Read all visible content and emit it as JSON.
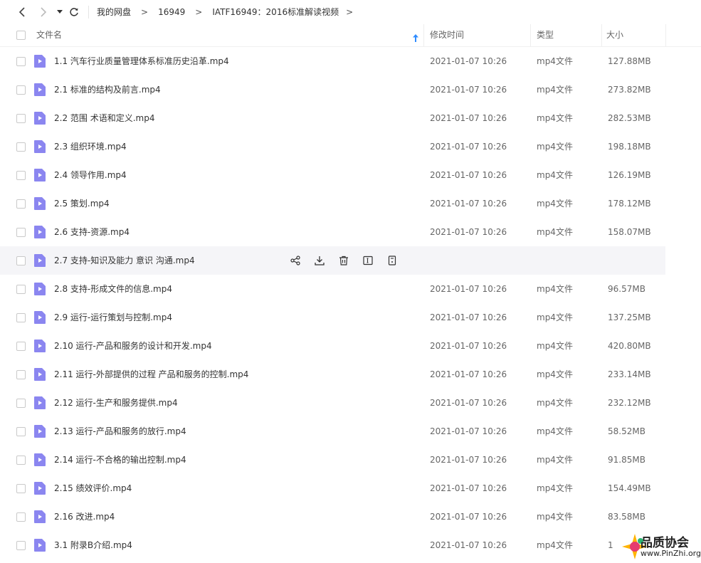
{
  "breadcrumb": {
    "items": [
      "我的网盘",
      "16949",
      "IATF16949：2016标准解读视频"
    ],
    "separator": ">"
  },
  "columns": {
    "name": "文件名",
    "modified": "修改时间",
    "type": "类型",
    "size": "大小"
  },
  "files": [
    {
      "name": "1.1 汽车行业质量管理体系标准历史沿革.mp4",
      "date": "2021-01-07 10:26",
      "type": "mp4文件",
      "size": "127.88MB"
    },
    {
      "name": "2.1 标准的结构及前言.mp4",
      "date": "2021-01-07 10:26",
      "type": "mp4文件",
      "size": "273.82MB"
    },
    {
      "name": "2.2 范围 术语和定义.mp4",
      "date": "2021-01-07 10:26",
      "type": "mp4文件",
      "size": "282.53MB"
    },
    {
      "name": "2.3 组织环境.mp4",
      "date": "2021-01-07 10:26",
      "type": "mp4文件",
      "size": "198.18MB"
    },
    {
      "name": "2.4 领导作用.mp4",
      "date": "2021-01-07 10:26",
      "type": "mp4文件",
      "size": "126.19MB"
    },
    {
      "name": "2.5 策划.mp4",
      "date": "2021-01-07 10:26",
      "type": "mp4文件",
      "size": "178.12MB"
    },
    {
      "name": "2.6 支持-资源.mp4",
      "date": "2021-01-07 10:26",
      "type": "mp4文件",
      "size": "158.07MB"
    },
    {
      "name": "2.7 支持-知识及能力 意识 沟通.mp4",
      "date": "",
      "type": "",
      "size": ""
    },
    {
      "name": "2.8 支持-形成文件的信息.mp4",
      "date": "2021-01-07 10:26",
      "type": "mp4文件",
      "size": "96.57MB"
    },
    {
      "name": "2.9 运行-运行策划与控制.mp4",
      "date": "2021-01-07 10:26",
      "type": "mp4文件",
      "size": "137.25MB"
    },
    {
      "name": "2.10 运行-产品和服务的设计和开发.mp4",
      "date": "2021-01-07 10:26",
      "type": "mp4文件",
      "size": "420.80MB"
    },
    {
      "name": "2.11 运行-外部提供的过程 产品和服务的控制.mp4",
      "date": "2021-01-07 10:26",
      "type": "mp4文件",
      "size": "233.14MB"
    },
    {
      "name": "2.12 运行-生产和服务提供.mp4",
      "date": "2021-01-07 10:26",
      "type": "mp4文件",
      "size": "232.12MB"
    },
    {
      "name": "2.13 运行-产品和服务的放行.mp4",
      "date": "2021-01-07 10:26",
      "type": "mp4文件",
      "size": "58.52MB"
    },
    {
      "name": "2.14 运行-不合格的输出控制.mp4",
      "date": "2021-01-07 10:26",
      "type": "mp4文件",
      "size": "91.85MB"
    },
    {
      "name": "2.15 绩效评价.mp4",
      "date": "2021-01-07 10:26",
      "type": "mp4文件",
      "size": "154.49MB"
    },
    {
      "name": "2.16 改进.mp4",
      "date": "2021-01-07 10:26",
      "type": "mp4文件",
      "size": "83.58MB"
    },
    {
      "name": "3.1 附录B介绍.mp4",
      "date": "2021-01-07 10:26",
      "type": "mp4文件",
      "size": "1"
    }
  ],
  "hover_actions": [
    "share-icon",
    "download-icon",
    "delete-icon",
    "rename-icon",
    "more-icon"
  ],
  "watermark": {
    "title": "品质协会",
    "url": "www.PinZhi.org"
  },
  "colors": {
    "file_icon": "#8b86f0",
    "sort_arrow": "#2f8cff",
    "hover_row": "#f5f5f8"
  }
}
